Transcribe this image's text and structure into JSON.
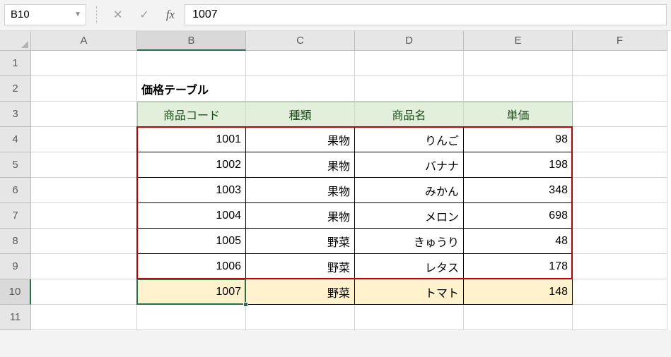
{
  "formula_bar": {
    "name_box": "B10",
    "cancel": "✕",
    "enter": "✓",
    "fx": "fx",
    "value": "1007"
  },
  "columns": [
    "A",
    "B",
    "C",
    "D",
    "E",
    "F"
  ],
  "rows": [
    "1",
    "2",
    "3",
    "4",
    "5",
    "6",
    "7",
    "8",
    "9",
    "10",
    "11"
  ],
  "active_row": "10",
  "active_col": "B",
  "table_title": "価格テーブル",
  "headers": {
    "code": "商品コード",
    "kind": "種類",
    "name": "商品名",
    "price": "単価"
  },
  "data": [
    {
      "code": "1001",
      "kind": "果物",
      "name": "りんご",
      "price": "98"
    },
    {
      "code": "1002",
      "kind": "果物",
      "name": "バナナ",
      "price": "198"
    },
    {
      "code": "1003",
      "kind": "果物",
      "name": "みかん",
      "price": "348"
    },
    {
      "code": "1004",
      "kind": "果物",
      "name": "メロン",
      "price": "698"
    },
    {
      "code": "1005",
      "kind": "野菜",
      "name": "きゅうり",
      "price": "48"
    },
    {
      "code": "1006",
      "kind": "野菜",
      "name": "レタス",
      "price": "178"
    },
    {
      "code": "1007",
      "kind": "野菜",
      "name": "トマト",
      "price": "148"
    }
  ],
  "chart_data": {
    "type": "table",
    "title": "価格テーブル",
    "columns": [
      "商品コード",
      "種類",
      "商品名",
      "単価"
    ],
    "rows": [
      [
        "1001",
        "果物",
        "りんご",
        98
      ],
      [
        "1002",
        "果物",
        "バナナ",
        198
      ],
      [
        "1003",
        "果物",
        "みかん",
        348
      ],
      [
        "1004",
        "果物",
        "メロン",
        698
      ],
      [
        "1005",
        "野菜",
        "きゅうり",
        48
      ],
      [
        "1006",
        "野菜",
        "レタス",
        178
      ],
      [
        "1007",
        "野菜",
        "トマト",
        148
      ]
    ]
  }
}
